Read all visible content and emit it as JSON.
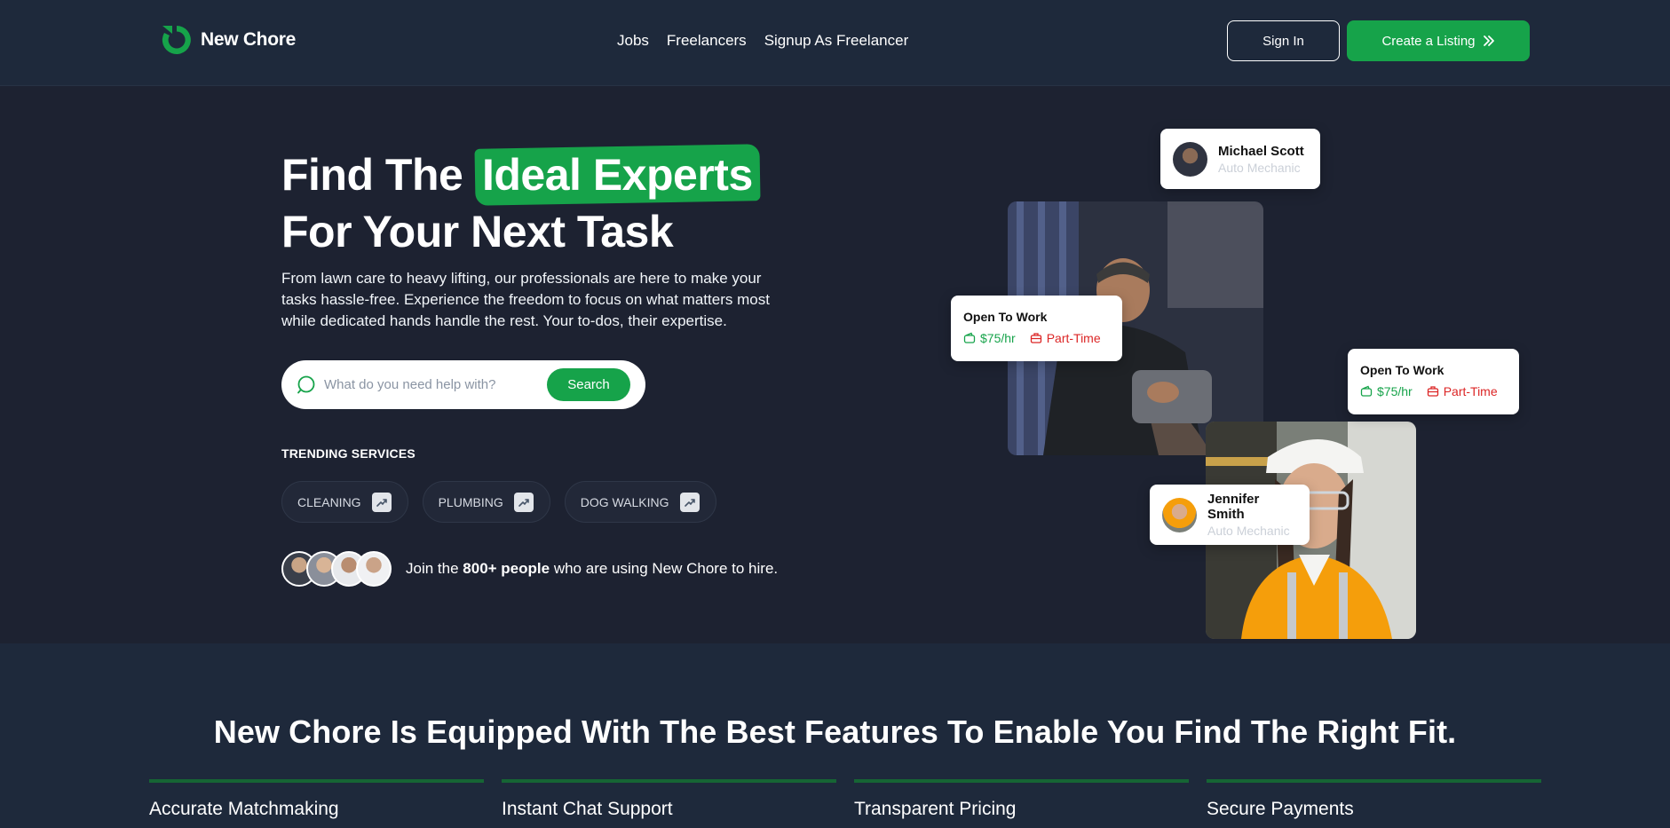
{
  "brand": {
    "name": "New Chore",
    "accent": "#16a34a"
  },
  "nav": {
    "items": [
      "Jobs",
      "Freelancers",
      "Signup As Freelancer"
    ]
  },
  "header": {
    "signin_label": "Sign In",
    "create_label": "Create a Listing"
  },
  "hero": {
    "title_prefix": "Find The",
    "title_highlight": "Ideal Experts",
    "title_line2": "For Your Next Task",
    "subtitle": "From lawn care to heavy lifting, our professionals are here to make your tasks hassle-free. Experience the freedom to focus on what matters most while dedicated hands handle the rest. Your to-dos, their expertise.",
    "search": {
      "placeholder": "What do you need help with?",
      "button_label": "Search"
    },
    "trending_title": "TRENDING SERVICES",
    "trending": [
      "CLEANING",
      "PLUMBING",
      "DOG WALKING"
    ],
    "join": {
      "prefix": "Join the",
      "count": "800+ people",
      "suffix": "who are using New Chore to hire."
    }
  },
  "cards": {
    "profile1": {
      "name": "Michael Scott",
      "role": "Auto Mechanic"
    },
    "work1": {
      "title": "Open To Work",
      "rate": "$75/hr",
      "type": "Part-Time"
    },
    "work2": {
      "title": "Open To Work",
      "rate": "$75/hr",
      "type": "Part-Time"
    },
    "profile2": {
      "name": "Jennifer Smith",
      "role": "Auto Mechanic"
    }
  },
  "features": {
    "title": "New Chore Is Equipped With The Best Features To Enable You Find The Right Fit.",
    "items": [
      "Accurate Matchmaking",
      "Instant Chat Support",
      "Transparent Pricing",
      "Secure Payments"
    ]
  },
  "icons": {
    "logo": "new-chore-logo-icon",
    "search": "search-icon",
    "trend": "trending-up-icon",
    "double_chevron": "double-chevron-right-icon",
    "wallet": "wallet-icon",
    "briefcase": "briefcase-icon"
  }
}
